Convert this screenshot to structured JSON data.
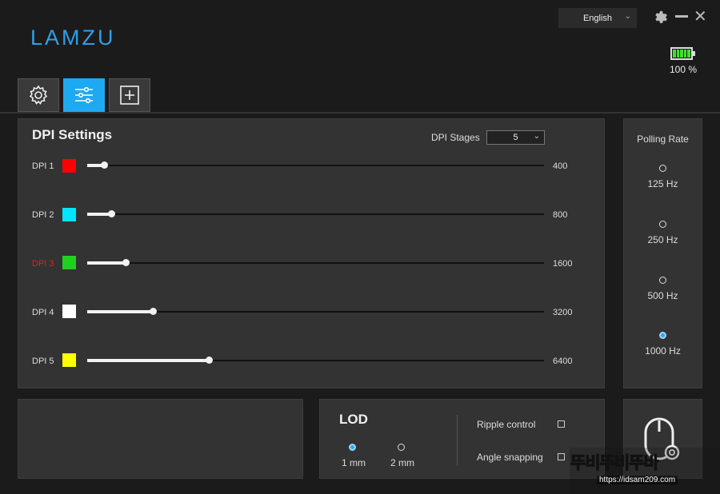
{
  "app": {
    "logo": "LAMZU"
  },
  "header": {
    "language": "English",
    "battery_percent": "100 %",
    "battery_level": 1.0,
    "icons": [
      "settings-icon",
      "minimize-icon",
      "close-icon",
      "battery-icon"
    ]
  },
  "tabs": [
    {
      "name": "settings",
      "icon": "gear-icon",
      "active": false
    },
    {
      "name": "performance",
      "icon": "sliders-icon",
      "active": true
    },
    {
      "name": "macro",
      "icon": "plus-box-icon",
      "active": false
    }
  ],
  "dpi": {
    "title": "DPI Settings",
    "stages_label": "DPI Stages",
    "stages_value": "5",
    "max_dpi": 26000,
    "items": [
      {
        "label": "DPI 1",
        "color": "#ff0000",
        "value": "400",
        "level": 0.0176,
        "active": false
      },
      {
        "label": "DPI 2",
        "color": "#00e5ff",
        "value": "800",
        "level": 0.0325,
        "active": false
      },
      {
        "label": "DPI 3",
        "color": "#1fd11f",
        "value": "1600",
        "level": 0.0652,
        "active": true
      },
      {
        "label": "DPI 4",
        "color": "#ffffff",
        "value": "3200",
        "level": 0.1243,
        "active": false
      },
      {
        "label": "DPI 5",
        "color": "#ffff00",
        "value": "6400",
        "level": 0.2469,
        "active": false
      }
    ],
    "active_label_color": "#e02020"
  },
  "polling": {
    "title": "Polling Rate",
    "options": [
      {
        "label": "125 Hz",
        "selected": false
      },
      {
        "label": "250 Hz",
        "selected": false
      },
      {
        "label": "500 Hz",
        "selected": false
      },
      {
        "label": "1000 Hz",
        "selected": true
      }
    ]
  },
  "lod": {
    "title": "LOD",
    "options": [
      {
        "label": "1 mm",
        "selected": true
      },
      {
        "label": "2 mm",
        "selected": false
      }
    ]
  },
  "options": {
    "ripple_label": "Ripple control",
    "ripple_checked": false,
    "angle_label": "Angle snapping",
    "angle_checked": false
  },
  "watermark": {
    "title": "뚜비뚜비뚜바",
    "url": "https://idsam209.com"
  },
  "colors": {
    "accent": "#1ea9f2",
    "logo": "#2f9fe8",
    "battery": "#3ee02a"
  }
}
